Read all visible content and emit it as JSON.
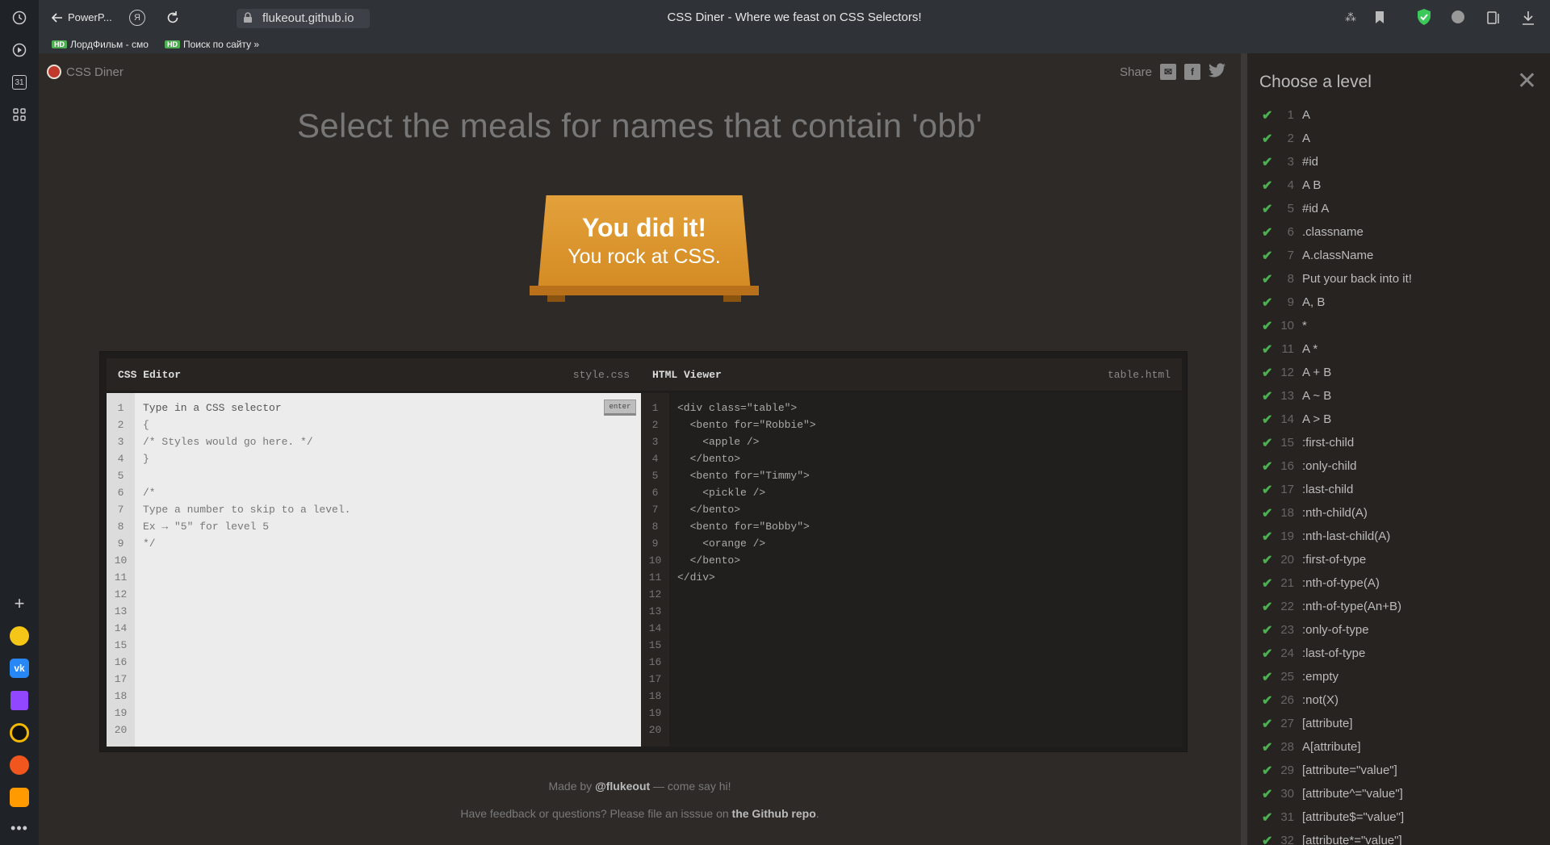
{
  "browser": {
    "tab_title": "PowerP...",
    "url": "flukeout.github.io",
    "page_title": "CSS Diner - Where we feast on CSS Selectors!",
    "bookmarks": [
      {
        "label": "ЛордФильм - смо"
      },
      {
        "label": "Поиск по сайту »"
      }
    ],
    "calendar_day": "31"
  },
  "app": {
    "logo": "CSS Diner",
    "share_label": "Share",
    "headline": "Select the meals for names that contain 'obb'",
    "plate_line1": "You did it!",
    "plate_line2": "You rock at CSS."
  },
  "css_editor": {
    "title": "CSS Editor",
    "filename": "style.css",
    "enter_label": "enter",
    "lines": [
      "Type in a CSS selector",
      "{",
      "/* Styles would go here. */",
      "}",
      "",
      "/*",
      "Type a number to skip to a level.",
      "Ex → \"5\" for level 5",
      "*/",
      "",
      "",
      "",
      "",
      "",
      "",
      "",
      "",
      "",
      "",
      ""
    ]
  },
  "html_viewer": {
    "title": "HTML Viewer",
    "filename": "table.html",
    "lines": [
      "<div class=\"table\">",
      "  <bento for=\"Robbie\">",
      "    <apple />",
      "  </bento>",
      "  <bento for=\"Timmy\">",
      "    <pickle />",
      "  </bento>",
      "  <bento for=\"Bobby\">",
      "    <orange />",
      "  </bento>",
      "</div>",
      "",
      "",
      "",
      "",
      "",
      "",
      "",
      "",
      ""
    ]
  },
  "footer": {
    "made_by_prefix": "Made by ",
    "made_by_handle": "@flukeout",
    "made_by_suffix": " — come say hi!",
    "feedback_prefix": "Have feedback or questions? Please file an isssue on ",
    "feedback_link": "the Github repo",
    "feedback_suffix": "."
  },
  "levels_panel": {
    "title": "Choose a level",
    "levels": [
      {
        "num": "1",
        "name": "A"
      },
      {
        "num": "2",
        "name": "A"
      },
      {
        "num": "3",
        "name": "#id"
      },
      {
        "num": "4",
        "name": "A  B"
      },
      {
        "num": "5",
        "name": "#id  A"
      },
      {
        "num": "6",
        "name": ".classname"
      },
      {
        "num": "7",
        "name": "A.className"
      },
      {
        "num": "8",
        "name": "Put your back into it!"
      },
      {
        "num": "9",
        "name": "A, B"
      },
      {
        "num": "10",
        "name": "*"
      },
      {
        "num": "11",
        "name": "A *"
      },
      {
        "num": "12",
        "name": "A + B"
      },
      {
        "num": "13",
        "name": "A ~ B"
      },
      {
        "num": "14",
        "name": "A > B"
      },
      {
        "num": "15",
        "name": ":first-child"
      },
      {
        "num": "16",
        "name": ":only-child"
      },
      {
        "num": "17",
        "name": ":last-child"
      },
      {
        "num": "18",
        "name": ":nth-child(A)"
      },
      {
        "num": "19",
        "name": ":nth-last-child(A)"
      },
      {
        "num": "20",
        "name": ":first-of-type"
      },
      {
        "num": "21",
        "name": ":nth-of-type(A)"
      },
      {
        "num": "22",
        "name": ":nth-of-type(An+B)"
      },
      {
        "num": "23",
        "name": ":only-of-type"
      },
      {
        "num": "24",
        "name": ":last-of-type"
      },
      {
        "num": "25",
        "name": ":empty"
      },
      {
        "num": "26",
        "name": ":not(X)"
      },
      {
        "num": "27",
        "name": "[attribute]"
      },
      {
        "num": "28",
        "name": "A[attribute]"
      },
      {
        "num": "29",
        "name": "[attribute=\"value\"]"
      },
      {
        "num": "30",
        "name": "[attribute^=\"value\"]"
      },
      {
        "num": "31",
        "name": "[attribute$=\"value\"]"
      },
      {
        "num": "32",
        "name": "[attribute*=\"value\"]"
      }
    ]
  }
}
